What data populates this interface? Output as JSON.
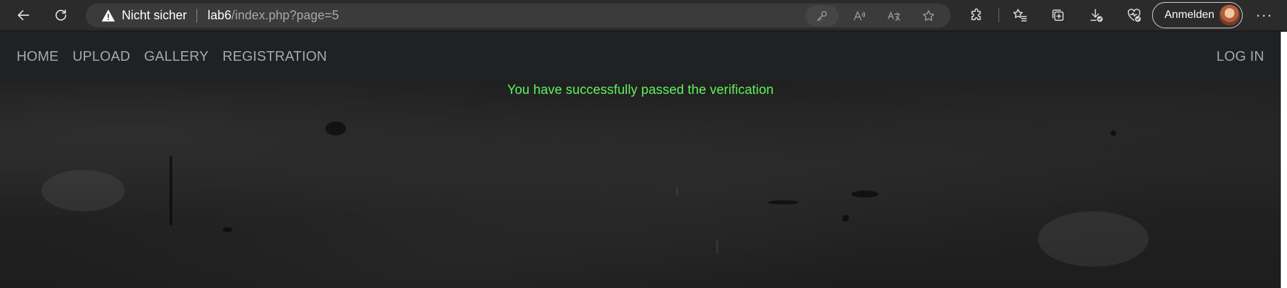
{
  "browser": {
    "security_label": "Nicht sicher",
    "url_host": "lab6",
    "url_path": "/index.php?page=5",
    "signin_label": "Anmelden",
    "more_label": "···"
  },
  "site": {
    "nav_items": [
      "HOME",
      "UPLOAD",
      "GALLERY",
      "REGISTRATION"
    ],
    "login_label": "LOG IN",
    "verification_message": "You have successfully passed the verification"
  },
  "colors": {
    "message": "#5ef55e",
    "nav_bg": "#1f2123",
    "browser_bg": "#2b2b2b"
  },
  "icons": {
    "back": "back-arrow-icon",
    "reload": "reload-icon",
    "warning": "warning-icon",
    "key": "key-icon",
    "read_aloud": "read-aloud-icon",
    "translate": "translate-icon",
    "favorite": "star-icon",
    "extensions": "puzzle-icon",
    "favorites": "favorites-list-icon",
    "collections": "collections-icon",
    "downloads": "download-icon",
    "health": "browser-essentials-icon"
  }
}
